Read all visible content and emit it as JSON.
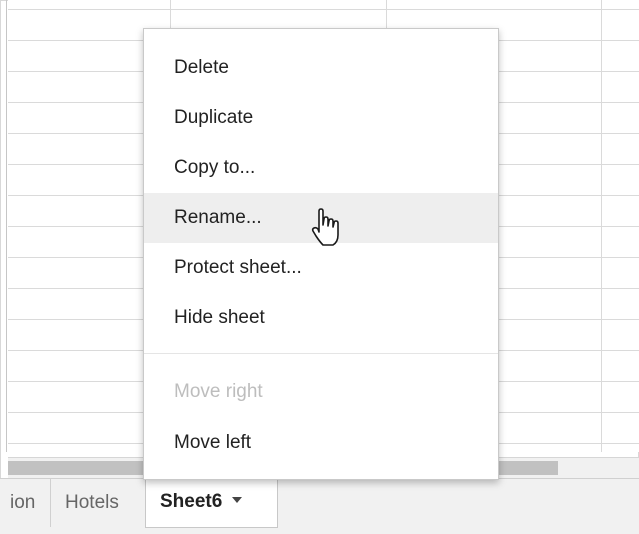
{
  "menu": {
    "items": [
      {
        "label": "Delete",
        "state": "normal"
      },
      {
        "label": "Duplicate",
        "state": "normal"
      },
      {
        "label": "Copy to...",
        "state": "normal"
      },
      {
        "label": "Rename...",
        "state": "hover"
      },
      {
        "label": "Protect sheet...",
        "state": "normal"
      },
      {
        "label": "Hide sheet",
        "state": "normal"
      },
      {
        "label": "Move right",
        "state": "disabled"
      },
      {
        "label": "Move left",
        "state": "normal"
      }
    ]
  },
  "tabs": {
    "partial_label": "ion",
    "hotels_label": "Hotels",
    "active_label": "Sheet6"
  },
  "cursor": {
    "icon": "hand-pointer-icon"
  },
  "colors": {
    "menu_hover": "#eeeeee",
    "disabled_text": "#bdbdbd",
    "tabbar_bg": "#f1f1f1"
  }
}
